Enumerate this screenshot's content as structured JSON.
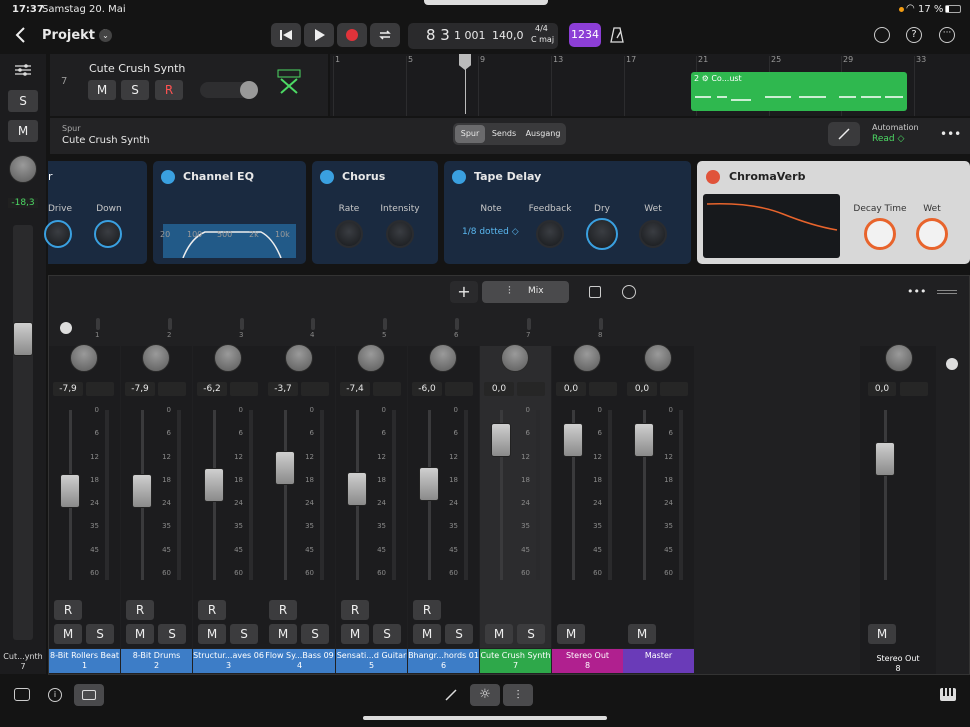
{
  "status": {
    "time": "17:37",
    "date": "Samstag 20. Mai",
    "battery": "17 %"
  },
  "header": {
    "project": "Projekt 4",
    "position": "8 3",
    "beat": "1 001",
    "tempo": "140,0",
    "signature": "4/4",
    "key": "C maj",
    "count_in": "1234"
  },
  "track": {
    "number": "7",
    "name": "Cute Crush Synth",
    "mute": "M",
    "solo": "S",
    "record": "R",
    "region": "2 ⚙ Co...ust"
  },
  "ruler": [
    "1",
    "5",
    "9",
    "13",
    "17",
    "21",
    "25",
    "29",
    "33"
  ],
  "inspector": {
    "label": "Spur",
    "name": "Cute Crush Synth",
    "tabs": [
      "Spur",
      "Sends",
      "Ausgang"
    ],
    "automation_label": "Automation",
    "automation_value": "Read ◇"
  },
  "plugins": {
    "first": {
      "labels": [
        "Drive",
        "Down"
      ]
    },
    "eq": {
      "name": "Channel EQ",
      "freqs": [
        "20",
        "100",
        "500",
        "2k",
        "10k"
      ]
    },
    "chorus": {
      "name": "Chorus",
      "labels": [
        "Rate",
        "Intensity"
      ]
    },
    "delay": {
      "name": "Tape Delay",
      "labels": [
        "Note",
        "Feedback",
        "Dry",
        "Wet"
      ],
      "note_value": "1/8 dotted ◇"
    },
    "verb": {
      "name": "ChromaVerb",
      "labels": [
        "Decay Time",
        "Wet"
      ]
    }
  },
  "mixer_toolbar": {
    "add": "+",
    "mix": "Mix"
  },
  "left_strip": {
    "s": "S",
    "m": "M",
    "value": "-18,3",
    "name": "Cut...ynth",
    "num": "7"
  },
  "scale": [
    "0",
    "6",
    "12",
    "18",
    "24",
    "35",
    "45",
    "60"
  ],
  "channels": [
    {
      "num": "1",
      "vol": "-7,9",
      "name": "8-Bit Rollers Beat",
      "idx": "1",
      "color": "#3d7dc7",
      "fader": 0.55,
      "r": "R",
      "m": "M",
      "s": "S"
    },
    {
      "num": "2",
      "vol": "-7,9",
      "name": "8-Bit Drums",
      "idx": "2",
      "color": "#3d7dc7",
      "fader": 0.55,
      "r": "R",
      "m": "M",
      "s": "S"
    },
    {
      "num": "3",
      "vol": "-6,2",
      "name": "Structur...aves 06",
      "idx": "3",
      "color": "#3d7dc7",
      "fader": 0.52,
      "r": "R",
      "m": "M",
      "s": "S"
    },
    {
      "num": "4",
      "vol": "-3,7",
      "name": "Flow Sy...Bass 09",
      "idx": "4",
      "color": "#3d7dc7",
      "fader": 0.42,
      "r": "R",
      "m": "M",
      "s": "S"
    },
    {
      "num": "5",
      "vol": "-7,4",
      "name": "Sensati...d Guitar",
      "idx": "5",
      "color": "#3d7dc7",
      "fader": 0.54,
      "r": "R",
      "m": "M",
      "s": "S"
    },
    {
      "num": "6",
      "vol": "-6,0",
      "name": "Bhangr...hords 01",
      "idx": "6",
      "color": "#3d7dc7",
      "fader": 0.51,
      "r": "R",
      "m": "M",
      "s": "S"
    },
    {
      "num": "7",
      "vol": "0,0",
      "name": "Cute Crush Synth",
      "idx": "7",
      "color": "#2ea84a",
      "fader": 0.25,
      "r": "",
      "m": "M",
      "s": "S"
    },
    {
      "num": "8",
      "vol": "0,0",
      "name": "Stereo Out",
      "idx": "8",
      "color": "#b0208f",
      "fader": 0.25,
      "r": "",
      "m": "M",
      "s": ""
    },
    {
      "num": "",
      "vol": "0,0",
      "name": "Master",
      "idx": "",
      "color": "#6a3bb8",
      "fader": 0.25,
      "r": "",
      "m": "M",
      "s": ""
    }
  ],
  "right_strip": {
    "vol": "0,0",
    "m": "M",
    "name": "Stereo Out",
    "num": "8"
  }
}
